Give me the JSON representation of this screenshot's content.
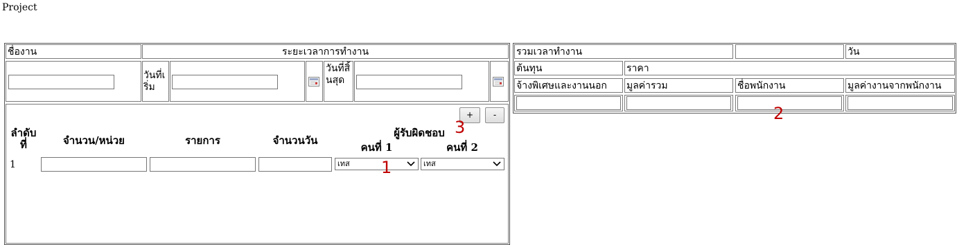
{
  "page_title": "Project",
  "left_header": {
    "job_name": "ชื่องาน",
    "work_period": "ระยะเวลาการทำงาน",
    "start_date": "วันที่เริ่ม",
    "end_date": "วันที่สิ้นสุด",
    "job_name_value": "",
    "start_date_value": "",
    "end_date_value": ""
  },
  "items_table": {
    "add_label": "+",
    "remove_label": "-",
    "columns": {
      "order": "ลำดับที่",
      "qty_unit": "จำนวน/หน่วย",
      "item": "รายการ",
      "days": "จำนวนวัน",
      "responsible": "ผู้รับผิดชอบ",
      "person1": "คนที่ 1",
      "person2": "คนที่ 2"
    },
    "rows": [
      {
        "order": "1",
        "qty_unit": "",
        "item": "",
        "days": "",
        "person1": "เทส",
        "person2": "เทส"
      }
    ]
  },
  "summary": {
    "total_time_label": "รวมเวลาทำงาน",
    "total_time_value": "",
    "unit_label": "วัน",
    "cost_label": "ต้นทุน",
    "price_label": "ราคา",
    "columns": [
      "จ้างพิเศษและงานนอก",
      "มูลค่ารวม",
      "ชื่อพนักงาน",
      "มูลค่างานจากพนักงาน"
    ],
    "values": [
      "",
      "",
      "",
      ""
    ]
  },
  "annotations": [
    "1",
    "2",
    "3"
  ]
}
